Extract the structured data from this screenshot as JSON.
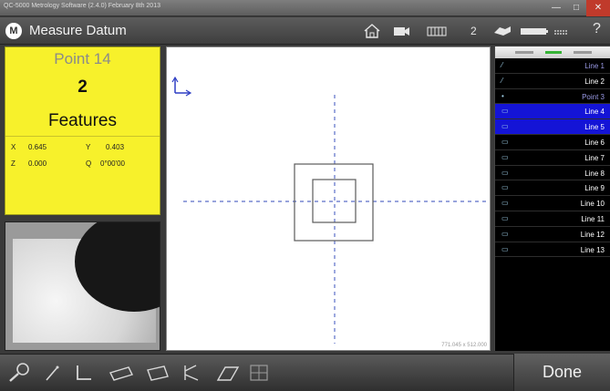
{
  "window": {
    "title": "QC-5000 Metrology Software (2.4.0) February 8th 2013",
    "minimize_glyph": "—",
    "maximize_glyph": "□",
    "close_glyph": "✕"
  },
  "header": {
    "logo": "M",
    "title": "Measure Datum",
    "count": "2",
    "help": "?",
    "icons": [
      "home-icon",
      "camera-icon",
      "display-icon",
      "hand-icon",
      "battery-icon",
      "signal-icon"
    ]
  },
  "feature_panel": {
    "name": "Point 14",
    "count": "2",
    "label": "Features",
    "readouts": {
      "x_label": "X",
      "x_value": "0.645",
      "y_label": "Y",
      "y_value": "0.403",
      "z_label": "Z",
      "z_value": "0.000",
      "q_label": "Q",
      "q_value": "0°00'00"
    }
  },
  "canvas": {
    "scale_text": "771.045 x 512.000"
  },
  "feature_list": {
    "items": [
      {
        "icon": "line-icon",
        "label": "Line 1",
        "selected": false,
        "dim": true
      },
      {
        "icon": "line-icon",
        "label": "Line 2",
        "selected": false,
        "dim": false
      },
      {
        "icon": "point-icon",
        "label": "Point 3",
        "selected": false,
        "dim": true
      },
      {
        "icon": "measure-icon",
        "label": "Line 4",
        "selected": true,
        "dim": false
      },
      {
        "icon": "measure-icon",
        "label": "Line 5",
        "selected": true,
        "dim": false
      },
      {
        "icon": "measure-icon",
        "label": "Line 6",
        "selected": false,
        "dim": false
      },
      {
        "icon": "measure-icon",
        "label": "Line 7",
        "selected": false,
        "dim": false
      },
      {
        "icon": "measure-icon",
        "label": "Line 8",
        "selected": false,
        "dim": false
      },
      {
        "icon": "measure-icon",
        "label": "Line 9",
        "selected": false,
        "dim": false
      },
      {
        "icon": "measure-icon",
        "label": "Line 10",
        "selected": false,
        "dim": false
      },
      {
        "icon": "measure-icon",
        "label": "Line 11",
        "selected": false,
        "dim": false
      },
      {
        "icon": "measure-icon",
        "label": "Line 12",
        "selected": false,
        "dim": false
      },
      {
        "icon": "measure-icon",
        "label": "Line 13",
        "selected": false,
        "dim": false
      }
    ]
  },
  "toolbar": {
    "tools": [
      "zoom-tool-icon",
      "line-tool-icon",
      "angle-tool-icon",
      "ellipse-tool-icon",
      "rectangle-tool-icon",
      "point-tool-icon",
      "parallelogram-tool-icon",
      "grid-tool-icon"
    ],
    "done_label": "Done"
  },
  "colors": {
    "feature_panel_bg": "#f7f12b",
    "selected_row": "#1414d6",
    "dashed_axis": "#5a6ec8",
    "close_button": "#c03a2b"
  }
}
